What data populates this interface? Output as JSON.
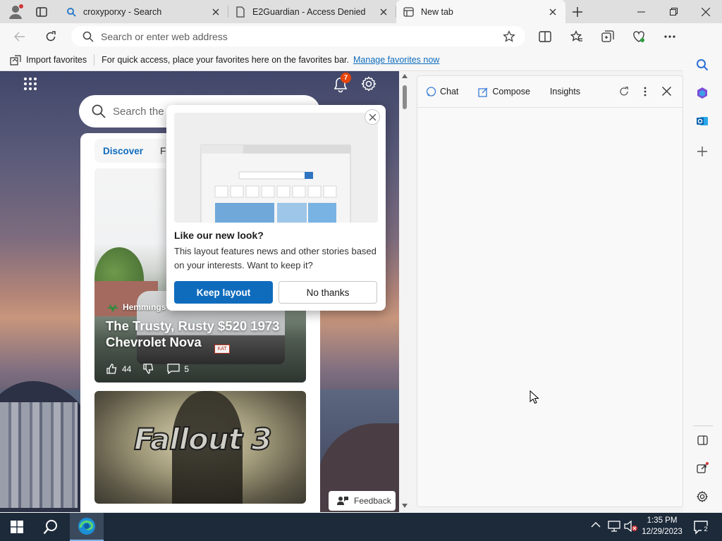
{
  "tabs": [
    {
      "title": "croxyporxy - Search",
      "active": false,
      "icon": "search-icon"
    },
    {
      "title": "E2Guardian - Access Denied",
      "active": false,
      "icon": "document-icon"
    },
    {
      "title": "New tab",
      "active": true,
      "icon": "newtab-icon"
    }
  ],
  "address_bar": {
    "placeholder": "Search or enter web address"
  },
  "favorites_bar": {
    "import_label": "Import favorites",
    "message": "For quick access, place your favorites here on the favorites bar.",
    "manage_link": "Manage favorites now"
  },
  "ntp": {
    "notification_count": "7",
    "search_placeholder": "Search the web",
    "feed_tabs": [
      "Discover",
      "Following"
    ],
    "cards": [
      {
        "source": "Hemmings",
        "title": "The Trusty, Rusty $520 1973 Chevrolet Nova",
        "likes": "44",
        "comments": "5",
        "plate_text": "KAT"
      },
      {
        "image_text": "Fallout 3"
      }
    ],
    "feedback_label": "Feedback"
  },
  "popup": {
    "heading": "Like our new look?",
    "body": "This layout features news and other stories based on your interests. Want to keep it?",
    "keep_button": "Keep layout",
    "no_button": "No thanks"
  },
  "sidepane": {
    "tabs": [
      "Chat",
      "Compose",
      "Insights"
    ]
  },
  "taskbar": {
    "time": "1:35 PM",
    "date": "12/29/2023",
    "notification_count": "2"
  },
  "colors": {
    "accent": "#0f6cbd",
    "badge": "#e8450a",
    "taskbar": "#1c2a3a"
  }
}
